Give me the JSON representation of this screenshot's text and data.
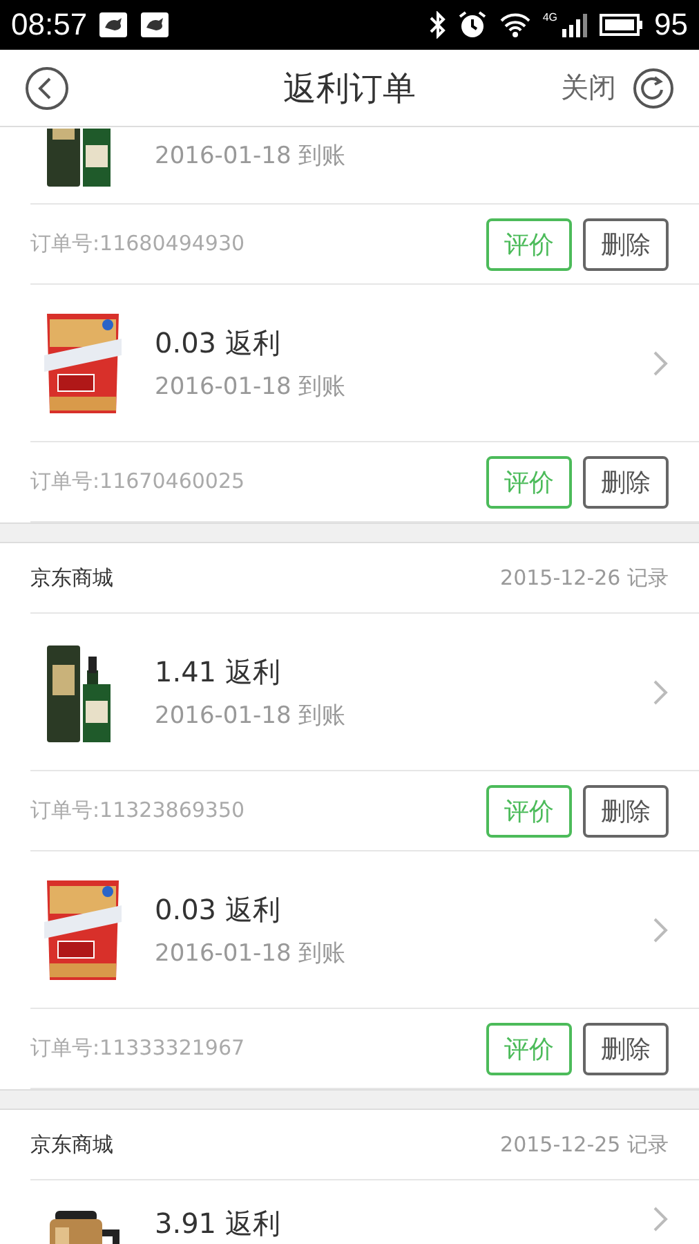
{
  "status_bar": {
    "time": "08:57",
    "network": "4G",
    "battery": "95"
  },
  "header": {
    "title": "返利订单",
    "close": "关闭"
  },
  "groups": [
    {
      "orders": [
        {
          "kind": "wine",
          "arrival": "2016-01-18 到账",
          "order_no": "订单号:11680494930",
          "review": "评价",
          "delete": "删除"
        },
        {
          "kind": "chips",
          "amount": "0.03 返利",
          "arrival": "2016-01-18 到账",
          "order_no": "订单号:11670460025",
          "review": "评价",
          "delete": "删除"
        }
      ]
    },
    {
      "store": "京东商城",
      "recorded": "2015-12-26 记录",
      "orders": [
        {
          "kind": "wine",
          "amount": "1.41 返利",
          "arrival": "2016-01-18 到账",
          "order_no": "订单号:11323869350",
          "review": "评价",
          "delete": "删除"
        },
        {
          "kind": "chips",
          "amount": "0.03 返利",
          "arrival": "2016-01-18 到账",
          "order_no": "订单号:11333321967",
          "review": "评价",
          "delete": "删除"
        }
      ]
    },
    {
      "store": "京东商城",
      "recorded": "2015-12-25 记录",
      "orders": [
        {
          "kind": "kettle",
          "amount": "3.91 返利"
        }
      ]
    }
  ]
}
